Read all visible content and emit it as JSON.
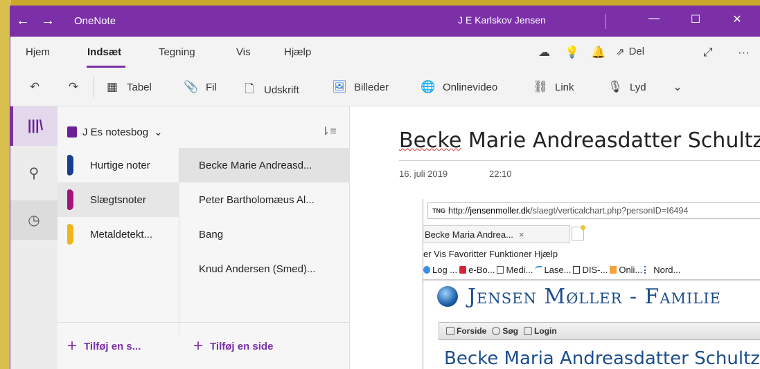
{
  "titlebar": {
    "app_name": "OneNote",
    "user_name": "J E Karlskov Jensen",
    "back_icon": "arrow-left-icon",
    "forward_icon": "arrow-right-icon"
  },
  "ribbon": {
    "tabs": [
      "Hjem",
      "Indsæt",
      "Tegning",
      "Vis",
      "Hjælp"
    ],
    "active_tab": "Indsæt",
    "share_label": "Del"
  },
  "toolbar": {
    "table_label": "Tabel",
    "file_label": "Fil",
    "printout_label": "Udskrift",
    "pictures_label": "Billeder",
    "online_video_label": "Onlinevideo",
    "link_label": "Link",
    "audio_label": "Lyd"
  },
  "notebook": {
    "name": "J Es notesbog"
  },
  "sections": [
    {
      "label": "Hurtige noter",
      "color": "#1b3f8f"
    },
    {
      "label": "Slægtsnoter",
      "color": "#a3157a"
    },
    {
      "label": "Metaldetekt...",
      "color": "#f1b51c"
    }
  ],
  "pages": [
    "Becke Marie Andreasd...",
    "Peter Bartholomæus Al...",
    "Bang",
    "Knud Andersen (Smed)..."
  ],
  "add_section_label": "Tilføj en s...",
  "add_page_label": "Tilføj en side",
  "page": {
    "title_underlined": "Becke",
    "title_rest": " Marie Andreasdatter Schultz",
    "date": "16. juli 2019",
    "time": "22:10"
  },
  "embedded": {
    "tng_label": "TNG",
    "url_scheme": "http://",
    "url_domain": "jensenmoller.dk",
    "url_rest": "/slaegt/verticalchart.php?personID=I6494",
    "tab_title": "Becke Maria Andrea...",
    "tab_close": "×",
    "menu": "er  Vis  Favoritter  Funktioner  Hjælp",
    "favorites": [
      "Log ...",
      "e-Bo...",
      "Medi...",
      "Lase...",
      "DIS-...",
      "Onli...",
      "Nord..."
    ],
    "site_title": "Jensen Møller - Familie",
    "site_nav": [
      "Forside",
      "Søg",
      "Login"
    ],
    "site_heading": "Becke Maria Andreasdatter Schultz"
  }
}
